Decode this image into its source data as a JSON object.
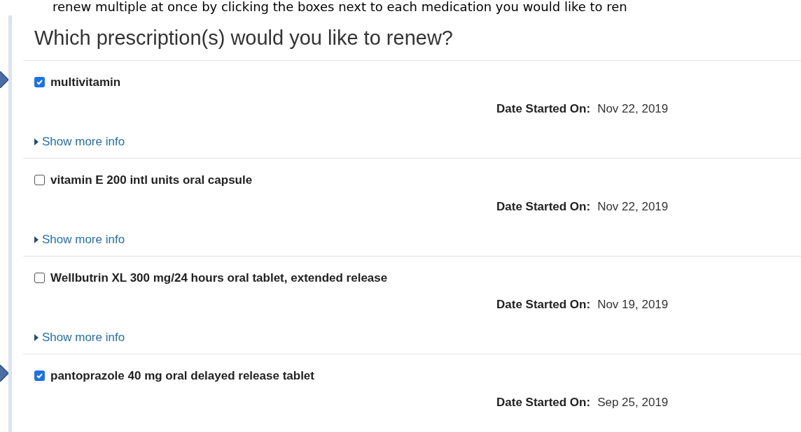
{
  "instruction_text": "renew multiple at once by clicking the boxes next to each medication you would like to ren",
  "heading": "Which prescription(s) would you like to renew?",
  "prescriptions": [
    {
      "name": "multivitamin",
      "checked": true,
      "date_label": "Date Started On:",
      "date": "Nov 22, 2019",
      "more_link": "Show more info"
    },
    {
      "name": "vitamin E 200 intl units oral capsule",
      "checked": false,
      "date_label": "Date Started On:",
      "date": "Nov 22, 2019",
      "more_link": "Show more info"
    },
    {
      "name": "Wellbutrin XL 300 mg/24 hours oral tablet, extended release",
      "checked": false,
      "date_label": "Date Started On:",
      "date": "Nov 19, 2019",
      "more_link": "Show more info"
    },
    {
      "name": "pantoprazole 40 mg oral delayed release tablet",
      "checked": true,
      "date_label": "Date Started On:",
      "date": "Sep 25, 2019"
    }
  ]
}
